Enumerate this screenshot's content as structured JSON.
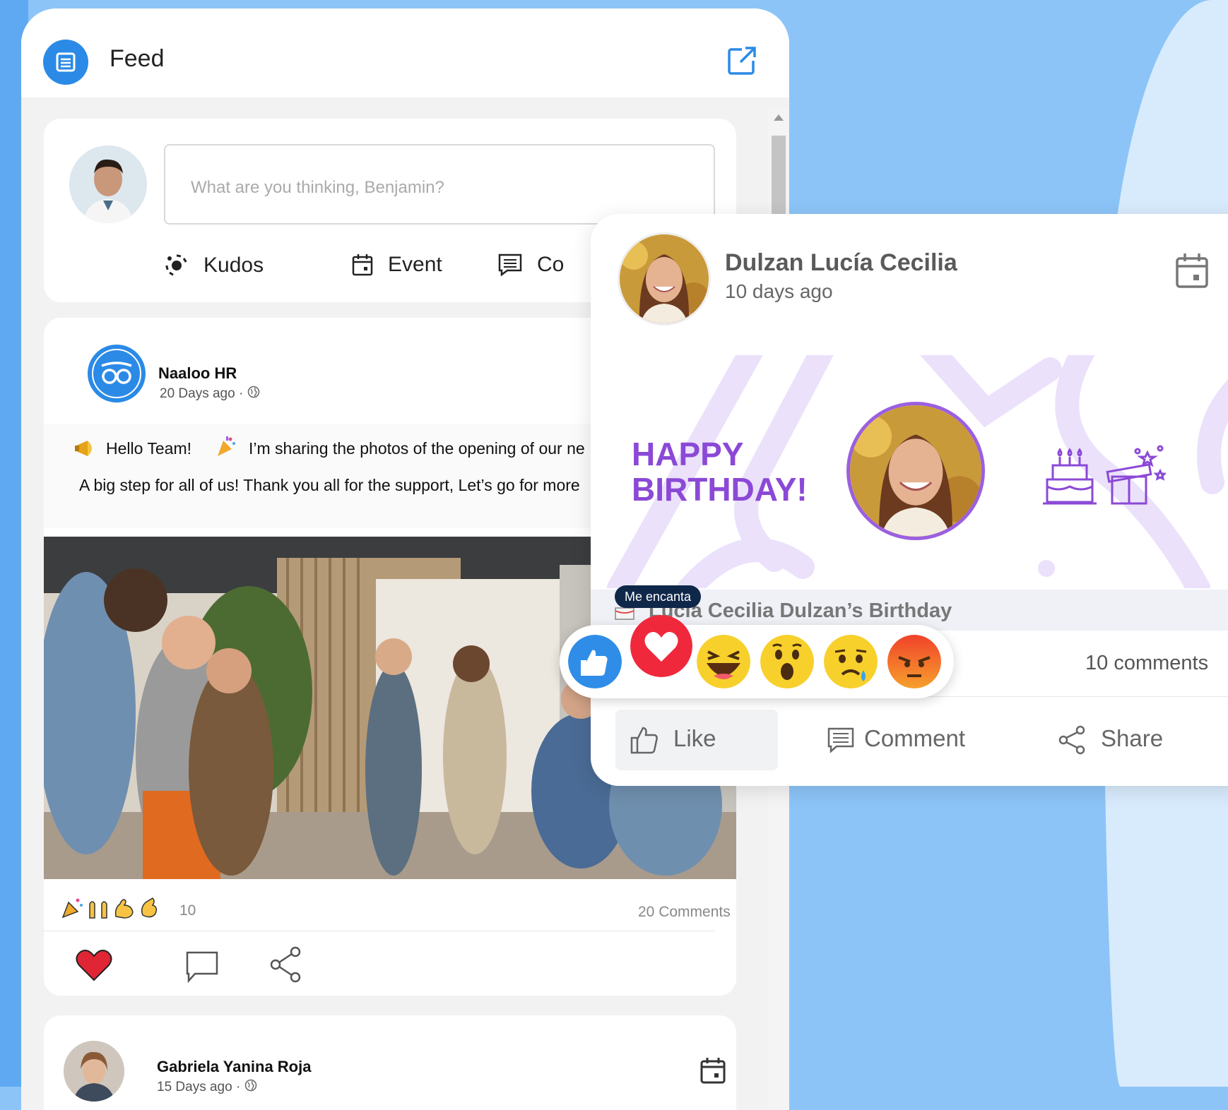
{
  "feed": {
    "title": "Feed",
    "composer": {
      "placeholder": "What are you thinking, Benjamin?",
      "actions": [
        {
          "label": "Kudos",
          "icon": "kudos-icon"
        },
        {
          "label": "Event",
          "icon": "calendar-icon"
        },
        {
          "label": "Co",
          "icon": "comment-icon"
        }
      ]
    },
    "post": {
      "author": "Naaloo HR",
      "time": "20 Days ago ·",
      "line1_a": "Hello Team!",
      "line1_b": "I’m sharing the photos of the opening of our ne",
      "line2": "A big step for all of us! Thank you all for the support, Let’s go for more",
      "reaction_count": "10",
      "comments": "20 Comments"
    },
    "post2": {
      "author": "Gabriela Yanina Roja",
      "time": "15 Days ago ·"
    }
  },
  "birthday_card": {
    "name": "Dulzan Lucía Cecilia",
    "time": "10 days ago",
    "banner_line1": "HAPPY",
    "banner_line2": "BIRTHDAY!",
    "event_title": "Lucía Cecilia Dulzan’s Birthday",
    "comments": "10 comments",
    "actions": {
      "like": "Like",
      "comment": "Comment",
      "share": "Share"
    },
    "tooltip": "Me encanta"
  },
  "colors": {
    "brand_blue": "#2b8ae6",
    "purple": "#8b49d6"
  }
}
